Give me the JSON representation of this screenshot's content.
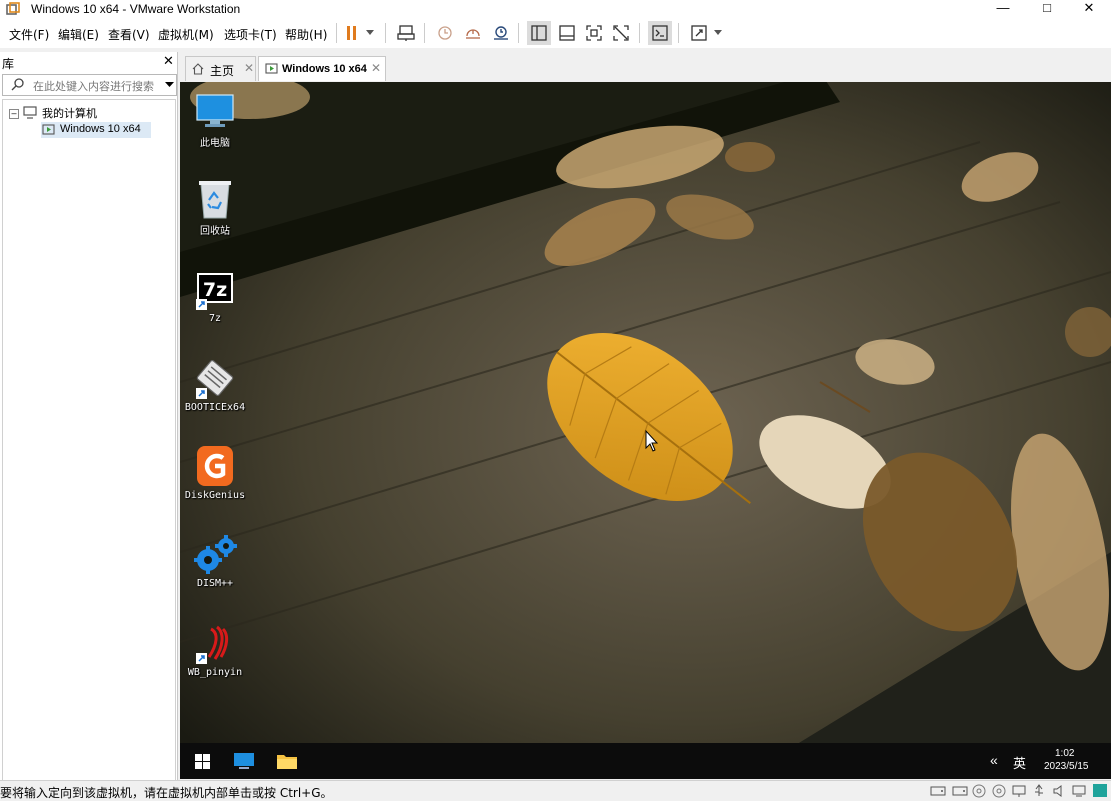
{
  "window": {
    "title": "Windows 10 x64 - VMware Workstation"
  },
  "menu": [
    "文件(F)",
    "编辑(E)",
    "查看(V)",
    "虚拟机(M)",
    "选项卡(T)",
    "帮助(H)"
  ],
  "library": {
    "header": "库",
    "search_placeholder": "在此处键入内容进行搜索",
    "tree": {
      "root": "我的计算机",
      "vm": "Windows 10 x64"
    }
  },
  "tabs": {
    "home": "主页",
    "vm": "Windows 10 x64"
  },
  "desktop": {
    "icons": [
      "此电脑",
      "回收站",
      "7z",
      "BOOTICEx64",
      "DiskGenius",
      "DISM++",
      "WB_pinyin"
    ]
  },
  "guest_taskbar": {
    "ime": "英",
    "time": "1:02",
    "date": "2023/5/15"
  },
  "status": "要将输入定向到该虚拟机，请在虚拟机内部单击或按 Ctrl+G。",
  "colors": {
    "pause_accent": "#e07b1e",
    "taskbar_bg": "#0c0c0c",
    "selected_bg": "#cce4f7"
  }
}
